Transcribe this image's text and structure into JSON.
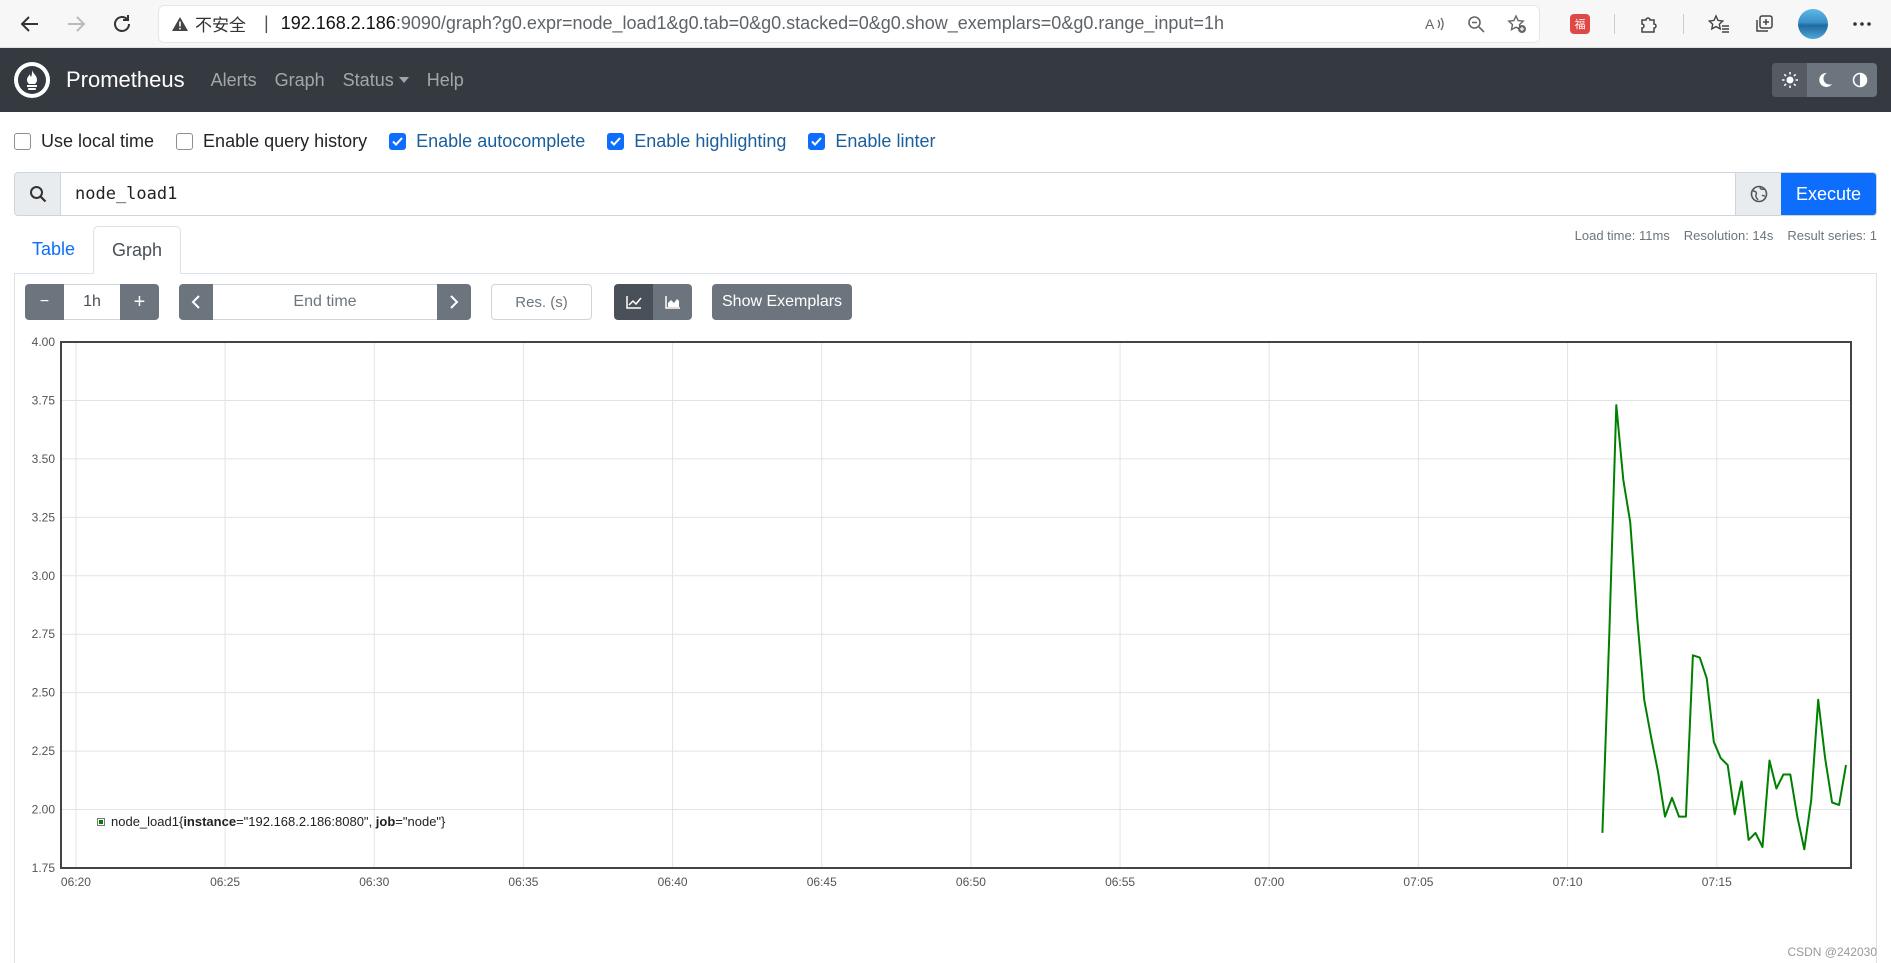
{
  "browser": {
    "security_label": "不安全",
    "separator": "|",
    "url_host": "192.168.2.186",
    "url_rest": ":9090/graph?g0.expr=node_load1&g0.tab=0&g0.stacked=0&g0.show_exemplars=0&g0.range_input=1h",
    "ext_label": "福"
  },
  "navbar": {
    "brand": "Prometheus",
    "links": [
      "Alerts",
      "Graph",
      "Status",
      "Help"
    ]
  },
  "options": [
    {
      "label": "Use local time",
      "checked": false
    },
    {
      "label": "Enable query history",
      "checked": false
    },
    {
      "label": "Enable autocomplete",
      "checked": true
    },
    {
      "label": "Enable highlighting",
      "checked": true
    },
    {
      "label": "Enable linter",
      "checked": true
    }
  ],
  "query": {
    "expression": "node_load1",
    "execute_label": "Execute"
  },
  "tabs": {
    "table": "Table",
    "graph": "Graph",
    "active": "Graph"
  },
  "stats": {
    "load_time": "Load time: 11ms",
    "resolution": "Resolution: 14s",
    "result_series": "Result series: 1"
  },
  "controls": {
    "minus": "−",
    "range": "1h",
    "plus": "+",
    "end_time_placeholder": "End time",
    "res_placeholder": "Res. (s)",
    "show_exemplars": "Show Exemplars"
  },
  "chart_data": {
    "type": "line",
    "ylim": [
      1.75,
      4.0
    ],
    "yticks": [
      "4.00",
      "3.75",
      "3.50",
      "3.25",
      "3.00",
      "2.75",
      "2.50",
      "2.25",
      "2.00",
      "1.75"
    ],
    "xticks": [
      "06:20",
      "06:25",
      "06:30",
      "06:35",
      "06:40",
      "06:45",
      "06:50",
      "06:55",
      "07:00",
      "07:05",
      "07:10",
      "07:15"
    ],
    "xlim_minutes": [
      "06:19:30",
      "07:19:30"
    ],
    "grid": true,
    "legend_position": "bottom-left",
    "series": [
      {
        "name": "node_load1",
        "color": "#008000",
        "x": [
          "07:11:10",
          "07:11:24",
          "07:11:38",
          "07:11:52",
          "07:12:06",
          "07:12:20",
          "07:12:34",
          "07:12:48",
          "07:13:02",
          "07:13:16",
          "07:13:30",
          "07:13:44",
          "07:13:58",
          "07:14:12",
          "07:14:26",
          "07:14:40",
          "07:14:54",
          "07:15:08",
          "07:15:22",
          "07:15:36",
          "07:15:50",
          "07:16:04",
          "07:16:18",
          "07:16:32",
          "07:16:46",
          "07:17:00",
          "07:17:14",
          "07:17:28",
          "07:17:42",
          "07:17:56",
          "07:18:10",
          "07:18:24",
          "07:18:38",
          "07:18:52",
          "07:19:06",
          "07:19:20"
        ],
        "values": [
          1.9,
          2.75,
          3.73,
          3.41,
          3.23,
          2.82,
          2.47,
          2.31,
          2.16,
          1.97,
          2.05,
          1.97,
          1.97,
          2.66,
          2.65,
          2.56,
          2.29,
          2.22,
          2.19,
          1.98,
          2.12,
          1.87,
          1.9,
          1.84,
          2.21,
          2.09,
          2.15,
          2.15,
          1.97,
          1.83,
          2.04,
          2.47,
          2.22,
          2.03,
          2.02,
          2.19
        ]
      }
    ]
  },
  "legend": {
    "metric": "node_load1",
    "open_brace": "{",
    "label1_key": "instance",
    "label1_val": "=\"192.168.2.186:8080\"",
    "comma": ", ",
    "label2_key": "job",
    "label2_val": "=\"node\"",
    "close_brace": "}"
  },
  "watermark": "CSDN @242030"
}
